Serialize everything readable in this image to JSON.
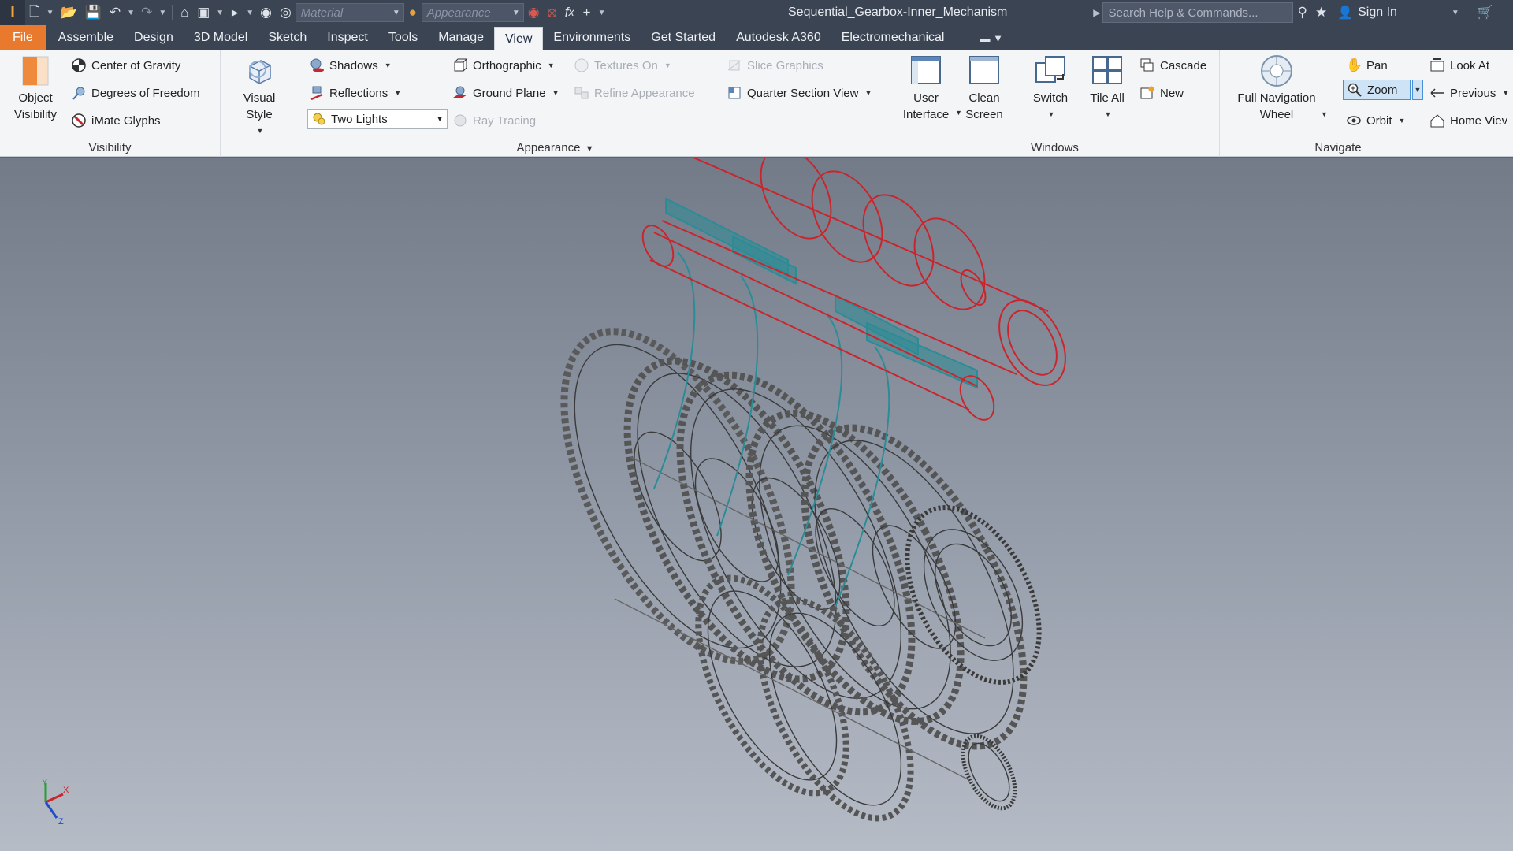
{
  "title": {
    "document": "Sequential_Gearbox-Inner_Mechanism",
    "material_placeholder": "Material",
    "appearance_placeholder": "Appearance",
    "search_placeholder": "Search Help & Commands...",
    "sign_in": "Sign In"
  },
  "tabs": [
    "File",
    "Assemble",
    "Design",
    "3D Model",
    "Sketch",
    "Inspect",
    "Tools",
    "Manage",
    "View",
    "Environments",
    "Get Started",
    "Autodesk A360",
    "Electromechanical"
  ],
  "active_tab": "View",
  "ribbon": {
    "visibility": {
      "title": "Visibility",
      "object_visibility": "Object\nVisibility",
      "object_visibility_l1": "Object",
      "object_visibility_l2": "Visibility",
      "center_of_gravity": "Center of Gravity",
      "degrees_of_freedom": "Degrees of Freedom",
      "imate_glyphs": "iMate Glyphs"
    },
    "appearance": {
      "title": "Appearance",
      "visual_style": "Visual Style",
      "shadows": "Shadows",
      "reflections": "Reflections",
      "lighting": "Two Lights",
      "orthographic": "Orthographic",
      "ground_plane": "Ground Plane",
      "ray_tracing": "Ray Tracing",
      "textures_on": "Textures On",
      "refine_appearance": "Refine Appearance",
      "slice_graphics": "Slice Graphics",
      "quarter_section_view": "Quarter Section View"
    },
    "windows": {
      "title": "Windows",
      "user_interface_l1": "User",
      "user_interface_l2": "Interface",
      "clean_screen_l1": "Clean",
      "clean_screen_l2": "Screen",
      "switch": "Switch",
      "tile_all": "Tile All",
      "cascade": "Cascade",
      "new": "New"
    },
    "navigate": {
      "title": "Navigate",
      "full_nav_wheel_l1": "Full Navigation",
      "full_nav_wheel_l2": "Wheel",
      "pan": "Pan",
      "zoom": "Zoom",
      "orbit": "Orbit",
      "look_at": "Look At",
      "previous": "Previous",
      "home_view": "Home Viev"
    }
  },
  "triad": {
    "x": "X",
    "y": "Y",
    "z": "Z"
  },
  "colors": {
    "file_tab": "#e8792d",
    "title_bar": "#3b4453",
    "shift_rail": "#c8262c",
    "shift_fork": "#2b8c96",
    "gear_lines": "#3a3a3a"
  }
}
